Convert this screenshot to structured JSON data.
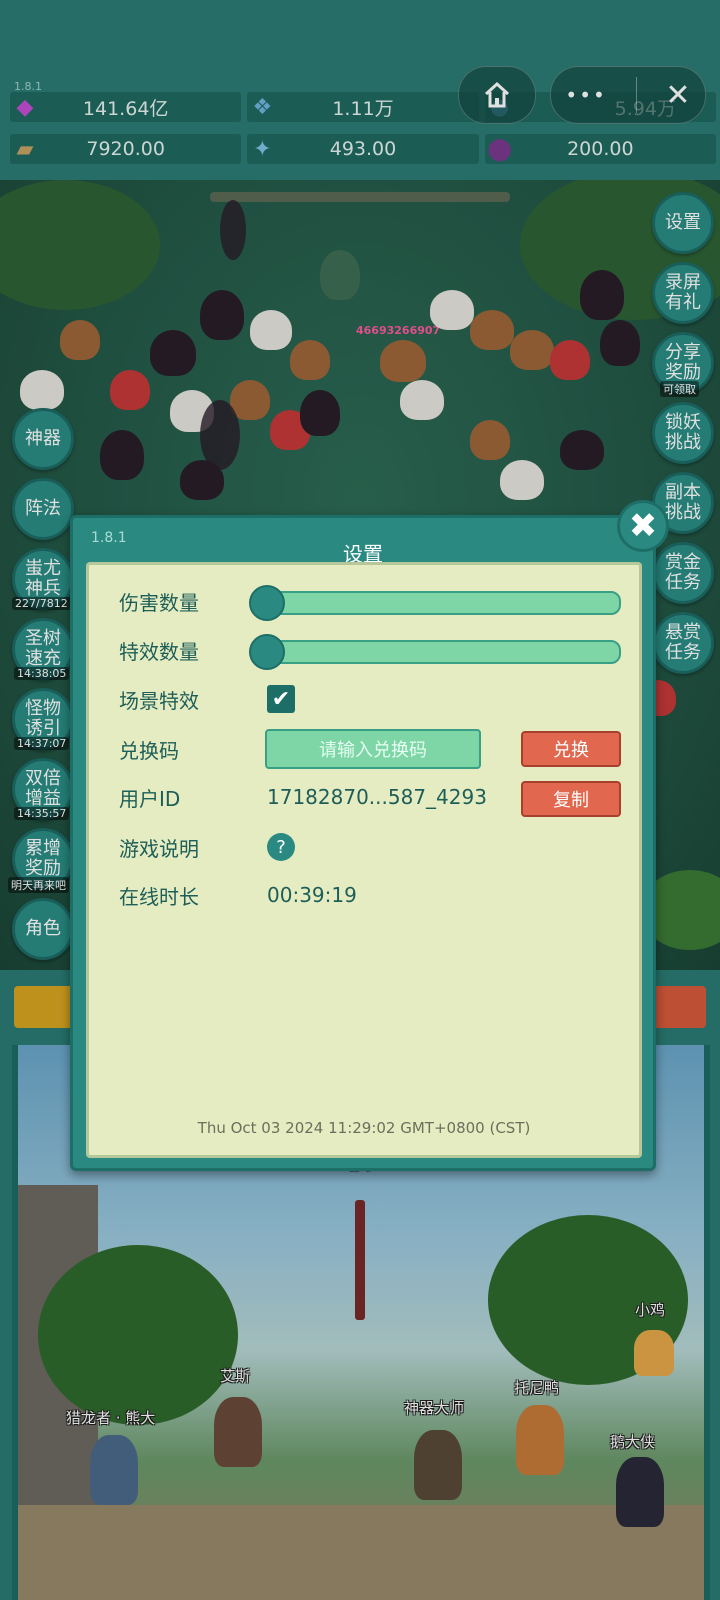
{
  "top": {
    "version": "1.8.1",
    "resources": [
      {
        "icon": "gem-icon",
        "value": "141.64亿",
        "color": "#c44fd6"
      },
      {
        "icon": "crystal-icon",
        "value": "1.11万",
        "color": "#6fb6e0"
      },
      {
        "icon": "orb-icon",
        "value": "5.94万",
        "color": "#4aa0c0"
      },
      {
        "icon": "scroll-icon",
        "value": "7920.00",
        "color": "#c9a466"
      },
      {
        "icon": "shard-icon",
        "value": "493.00",
        "color": "#7fc6e8"
      },
      {
        "icon": "potion-icon",
        "value": "200.00",
        "color": "#7a3b8f"
      }
    ],
    "capsule": {
      "home": "⌂",
      "more": "•••",
      "close": "✕"
    }
  },
  "battle": {
    "damage_text": "46693266907"
  },
  "left_menu": [
    {
      "label": "神器",
      "sub": ""
    },
    {
      "label": "阵法",
      "sub": ""
    },
    {
      "label": "蚩尤神兵",
      "sub": "227/7812"
    },
    {
      "label": "圣树速充",
      "sub": "14:38:05"
    },
    {
      "label": "怪物诱引",
      "sub": "14:37:07"
    },
    {
      "label": "双倍增益",
      "sub": "14:35:57"
    },
    {
      "label": "累增奖励",
      "sub": "明天再来吧"
    },
    {
      "label": "角色",
      "sub": ""
    }
  ],
  "right_menu": [
    {
      "label": "设置",
      "sub": ""
    },
    {
      "label": "录屏有礼",
      "sub": ""
    },
    {
      "label": "分享奖励",
      "sub": "可领取"
    },
    {
      "label": "锁妖挑战",
      "sub": ""
    },
    {
      "label": "副本挑战",
      "sub": ""
    },
    {
      "label": "赏金任务",
      "sub": ""
    },
    {
      "label": "悬赏任务",
      "sub": ""
    }
  ],
  "scene": {
    "npcs": [
      {
        "name": "剑灵"
      },
      {
        "name": "小鸡"
      },
      {
        "name": "艾斯"
      },
      {
        "name": "托尼鸭"
      },
      {
        "name": "猎龙者 · 熊大"
      },
      {
        "name": "神器大师"
      },
      {
        "name": "鹅大侠"
      }
    ]
  },
  "settings": {
    "version": "1.8.1",
    "title": "设置",
    "rows": {
      "damage_count": {
        "label": "伤害数量",
        "level": 0
      },
      "effect_count": {
        "label": "特效数量",
        "level": 0
      },
      "scene_effect": {
        "label": "场景特效",
        "checked": true,
        "check_glyph": "✔"
      },
      "redeem": {
        "label": "兑换码",
        "placeholder": "请输入兑换码",
        "button": "兑换"
      },
      "user_id": {
        "label": "用户ID",
        "value": "17182870...587_4293",
        "button": "复制"
      },
      "game_info": {
        "label": "游戏说明",
        "help_glyph": "?"
      },
      "online_time": {
        "label": "在线时长",
        "value": "00:39:19"
      }
    },
    "timestamp": "Thu Oct 03 2024 11:29:02 GMT+0800 (CST)",
    "close_glyph": "✖"
  }
}
